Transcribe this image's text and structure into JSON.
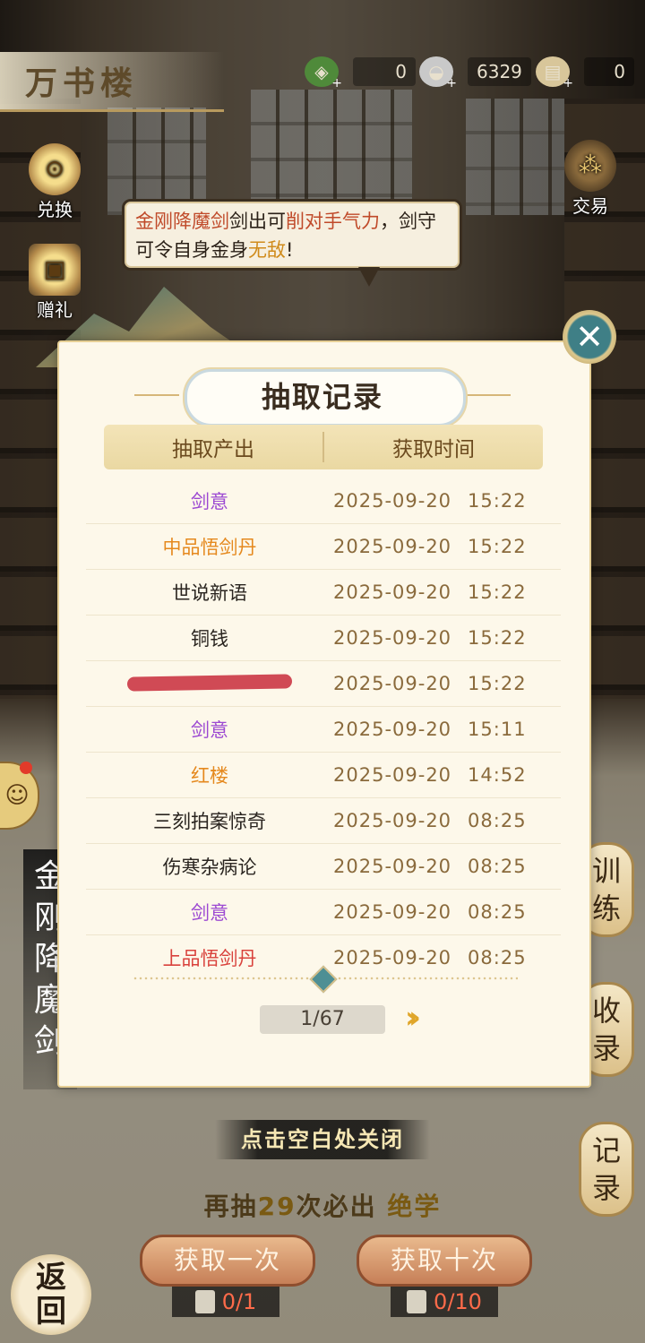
{
  "header": {
    "title": "万书楼",
    "resources": [
      {
        "icon": "jade-coin-icon",
        "value": "0"
      },
      {
        "icon": "silver-ingot-icon",
        "value": "6329"
      },
      {
        "icon": "scroll-ticket-icon",
        "value": "0"
      }
    ]
  },
  "side_left": [
    {
      "label": "兑换",
      "icon": "exchange-icon"
    },
    {
      "label": "赠礼",
      "icon": "gift-box-icon"
    }
  ],
  "side_right_top": {
    "label": "交易",
    "icon": "abacus-icon"
  },
  "speech": {
    "part1": "金刚降魔剑",
    "part2": "剑出可",
    "part3": "削对手气力",
    "part4": "，剑守可令自身金身",
    "part5": "无敌",
    "part6": "!"
  },
  "modal": {
    "title": "抽取记录",
    "col_item": "抽取产出",
    "col_time": "获取时间",
    "rows": [
      {
        "item": "剑意",
        "quality": "purple",
        "date": "2025-09-20",
        "time": "15:22"
      },
      {
        "item": "中品悟剑丹",
        "quality": "orange",
        "date": "2025-09-20",
        "time": "15:22"
      },
      {
        "item": "世说新语",
        "quality": "black",
        "date": "2025-09-20",
        "time": "15:22"
      },
      {
        "item": "铜钱",
        "quality": "black",
        "date": "2025-09-20",
        "time": "15:22"
      },
      {
        "item": "",
        "quality": "redacted",
        "date": "2025-09-20",
        "time": "15:22"
      },
      {
        "item": "剑意",
        "quality": "purple",
        "date": "2025-09-20",
        "time": "15:11"
      },
      {
        "item": "红楼",
        "quality": "orange",
        "date": "2025-09-20",
        "time": "14:52"
      },
      {
        "item": "三刻拍案惊奇",
        "quality": "black",
        "date": "2025-09-20",
        "time": "08:25"
      },
      {
        "item": "伤寒杂病论",
        "quality": "black",
        "date": "2025-09-20",
        "time": "08:25"
      },
      {
        "item": "剑意",
        "quality": "purple",
        "date": "2025-09-20",
        "time": "08:25"
      },
      {
        "item": "上品悟剑丹",
        "quality": "red",
        "date": "2025-09-20",
        "time": "08:25"
      }
    ],
    "page": "1/67",
    "next_icon": "double-chevron-right-icon",
    "close_icon": "close-icon"
  },
  "right_buttons": [
    "训练",
    "收录",
    "记录"
  ],
  "left_banner": "金刚降魔剑",
  "bottom": {
    "close_hint": "点击空白处关闭",
    "pity_prefix": "再抽",
    "pity_count": "29",
    "pity_suffix": "次必出",
    "pity_reward": "绝学",
    "draw_once": "获取一次",
    "draw_ten": "获取十次",
    "ticket_once": "0/1",
    "ticket_ten": "0/10",
    "back": "返回"
  },
  "colors": {
    "purple": "#9c49d2",
    "orange": "#e5891e",
    "black": "#2a2520",
    "red": "#d9423c",
    "time": "#8a6a3c"
  }
}
